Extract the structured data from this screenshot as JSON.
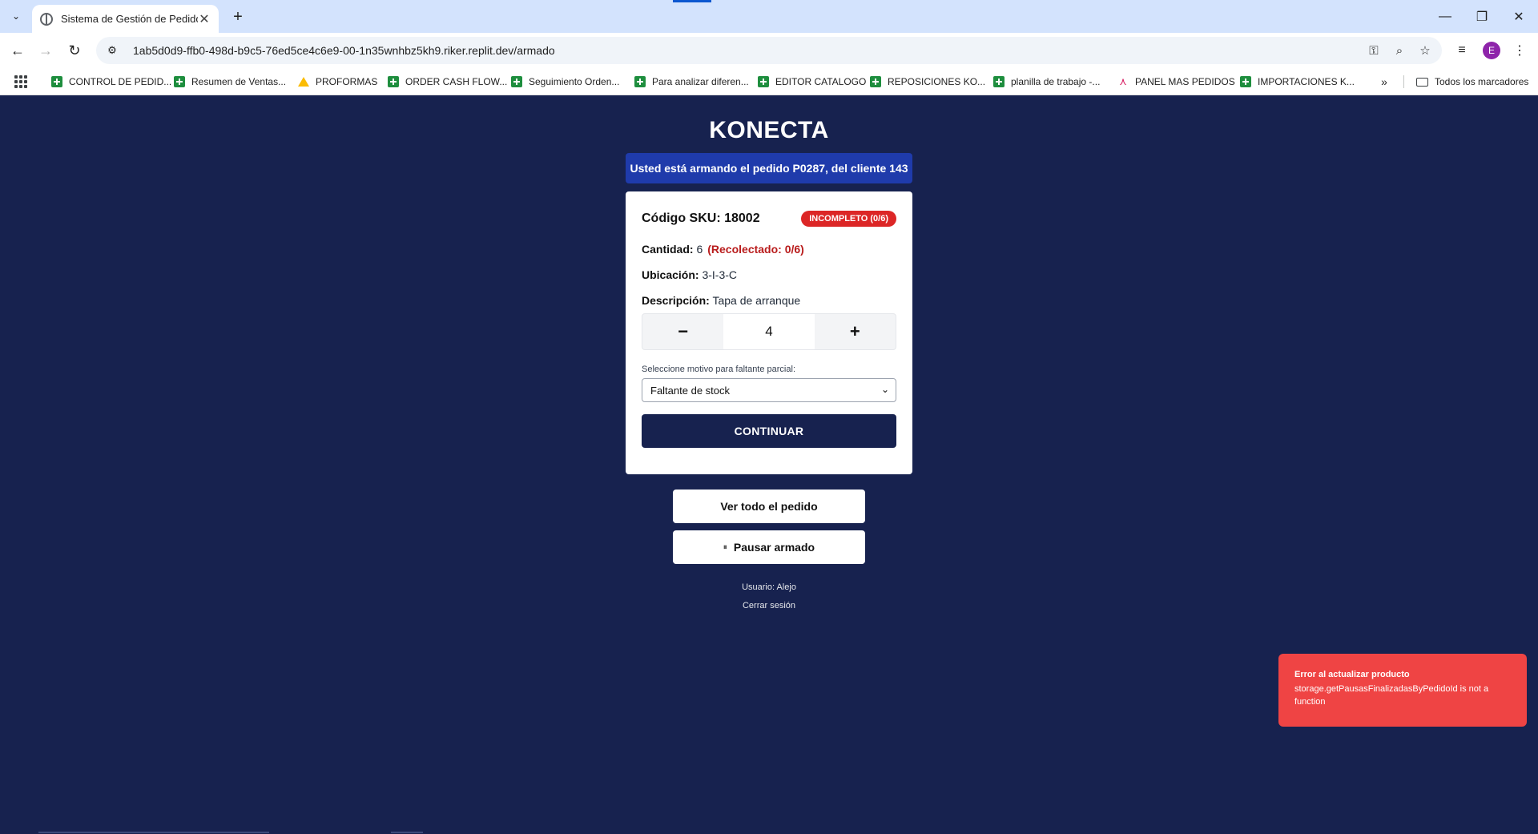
{
  "browser": {
    "tab_title": "Sistema de Gestión de Pedidos",
    "url": "1ab5d0d9-ffb0-498d-b9c5-76ed5ce4c6e9-00-1n35wnhbz5kh9.riker.replit.dev/armado",
    "avatar_letter": "E",
    "bookmarks": [
      {
        "label": "CONTROL DE PEDID...",
        "icon": "sheets-icon"
      },
      {
        "label": "Resumen de Ventas...",
        "icon": "sheets-icon"
      },
      {
        "label": "PROFORMAS",
        "icon": "drive-icon"
      },
      {
        "label": "ORDER CASH FLOW...",
        "icon": "sheets-icon"
      },
      {
        "label": "Seguimiento Orden...",
        "icon": "sheets-icon"
      },
      {
        "label": "Para analizar diferen...",
        "icon": "sheets-icon"
      },
      {
        "label": "EDITOR CATALOGO",
        "icon": "sheets-icon"
      },
      {
        "label": "REPOSICIONES KO...",
        "icon": "sheets-icon"
      },
      {
        "label": "planilla de trabajo -...",
        "icon": "sheets-icon"
      },
      {
        "label": "PANEL MAS PEDIDOS",
        "icon": "panel-icon"
      },
      {
        "label": "IMPORTACIONES K...",
        "icon": "sheets-icon"
      }
    ],
    "all_bookmarks_label": "Todos los marcadores"
  },
  "app": {
    "brand": "KONECTA",
    "banner": {
      "prefix": "Usted está armando el pedido ",
      "order": "P0287",
      "middle": ", del cliente ",
      "client": "143"
    },
    "item": {
      "sku_label": "Código SKU:",
      "sku_value": "18002",
      "status_badge": "INCOMPLETO (0/6)",
      "qty_label": "Cantidad:",
      "qty_value": "6",
      "collected": "(Recolectado: 0/6)",
      "location_label": "Ubicación:",
      "location_value": "3-I-3-C",
      "description_label": "Descripción:",
      "description_value": "Tapa de arranque"
    },
    "stepper": {
      "minus": "−",
      "value": "4",
      "plus": "+"
    },
    "reason": {
      "label": "Seleccione motivo para faltante parcial:",
      "selected": "Faltante de stock"
    },
    "continue_label": "CONTINUAR",
    "view_order_label": "Ver todo el pedido",
    "pause_label": "Pausar armado",
    "user_text": "Usuario: Alejo",
    "logout_label": "Cerrar sesión",
    "colors": {
      "background": "#17224f",
      "banner": "#1f3bab",
      "badge": "#dc2626",
      "toast": "#ef4444"
    }
  },
  "toast": {
    "title": "Error al actualizar producto",
    "message": "storage.getPausasFinalizadasByPedidoId is not a function"
  }
}
